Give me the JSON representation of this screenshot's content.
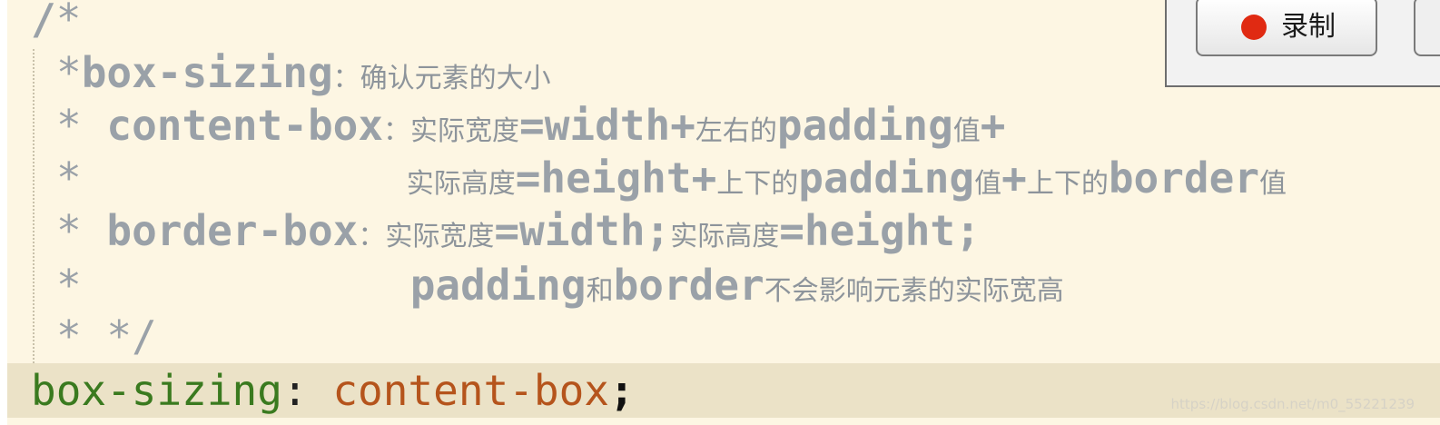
{
  "editor": {
    "comment_lines": [
      {
        "gutter": "/",
        "star": "*",
        "body": "",
        "extra": ""
      },
      {
        "gutter": "",
        "star": "*",
        "keyword": "box-sizing",
        "cn": "：确认元素的大小"
      },
      {
        "gutter": "",
        "star": "* ",
        "keyword": "content-box",
        "cn_pre": "：实际宽度",
        "code_mid": "=width+",
        "cn_mid": "左右的",
        "code_end": "padding",
        "cn_end": "值",
        "tail": "+"
      },
      {
        "gutter": "",
        "star": "*",
        "cn_a": "实际高度",
        "code_a": "=height+",
        "cn_b": "上下的",
        "code_b": "padding",
        "cn_c": "值",
        "code_c": "+",
        "cn_d": "上下的",
        "code_d": "border",
        "cn_e": "值"
      },
      {
        "gutter": "",
        "star": "* ",
        "keyword": "border-box",
        "cn_a": "：实际宽度",
        "code_a": "=width;",
        "cn_b": "实际高度",
        "code_b": "=height;"
      },
      {
        "gutter": "",
        "star": "*",
        "code_a": "padding",
        "cn_a": "和",
        "code_b": "border",
        "cn_b": "不会影响元素的实际宽高"
      },
      {
        "gutter": "",
        "star": "* */"
      }
    ],
    "code_line": {
      "property": "box-sizing",
      "colon": ":",
      "value": " content-box",
      "semicolon": ";"
    }
  },
  "record_panel": {
    "record_label": "录制",
    "record_color": "#e02a12"
  },
  "watermark": "https://blog.csdn.net/m0_55221239"
}
